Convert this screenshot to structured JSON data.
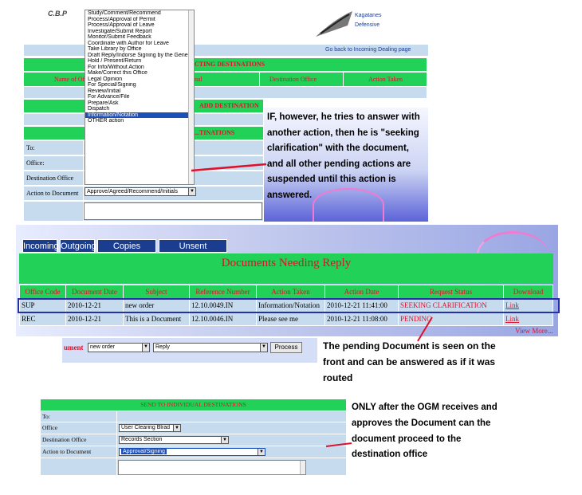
{
  "panel1": {
    "logo_text": "C.B.P",
    "brand_line1": "Kagatanes",
    "brand_line2": "Defensive",
    "back_link": "Go back to Incoming Dealing page",
    "section_header": "...CTING DESTINATIONS",
    "col_headers": [
      "Name of Off",
      "nal",
      "Destination Office",
      "Action Taken"
    ],
    "add_destination": "ADD DESTINATION",
    "second_header": "...TINATIONS",
    "form_labels": [
      "To:",
      "Office:",
      "Destination Office",
      "Action to Document"
    ],
    "action_select_value": "Approve/Agreed/Recommend/Initials",
    "dropdown_items": [
      "Study/Comment/Recommend",
      "Process/Approval of Permit",
      "Process/Approval of Leave",
      "Investigate/Submit Report",
      "Monitor/Submit Feedback",
      "Coordinate with Author for Leave",
      "Take Library by Office",
      "Draft Reply/Indorse Signing by the General Manager",
      "Hold / Present/Return",
      "For Info/Without Action",
      "Make/Correct this Office",
      "Legal Opinion",
      "For Special/Signing",
      "Review/Initial",
      "For Advance/File",
      "Prepare/Ask",
      "Dispatch",
      "Information/Notation",
      "OTHER action"
    ],
    "selected_index": 17
  },
  "callout1": "IF, however, he tries to answer with another action, then he is \"seeking clarification\" with the document, and all other pending actions are suspended until this action is answered.",
  "tabs": [
    "Incoming",
    "Outgoing",
    "Copies Received",
    "Unsent Documents"
  ],
  "docs_table": {
    "title": "Documents Needing Reply",
    "headers": [
      "Office Code",
      "Document Date",
      "Subject",
      "Reference Number",
      "Action Taken",
      "Action Date",
      "Request Status",
      "Download"
    ],
    "rows": [
      [
        "SUP",
        "2010-12-21",
        "new order",
        "12.10.0049.IN",
        "Information/Notation",
        "2010-12-21 11:41:00",
        "SEEKING CLARIFICATION",
        "Link"
      ],
      [
        "REC",
        "2010-12-21",
        "This is a Document",
        "12.10.0046.IN",
        "Please see me",
        "2010-12-21 11:08:00",
        "PENDING",
        "Link"
      ]
    ],
    "view_more": "View More..."
  },
  "reply_bar": {
    "label": "ument",
    "select1": "new order",
    "select2": "Reply",
    "button": "Process"
  },
  "callout2": "The pending Document is seen on the front and can be answered as if it was routed",
  "panel2": {
    "header": "SEND TO INDIVIDUAL DESTINATIONS",
    "labels": [
      "To:",
      "Office",
      "Destination Office",
      "Action to Document"
    ],
    "office_value": "User Clearing Blrad",
    "dest_value": "Records Section",
    "action_value": "Approval/Signing"
  },
  "callout3": "ONLY after the OGM receives and approves the Document can the document proceed to the destination office",
  "colors": {
    "green": "#22d158",
    "navy": "#1b3d8f",
    "red": "#e0102a",
    "highlight_border": "#2330a8"
  }
}
